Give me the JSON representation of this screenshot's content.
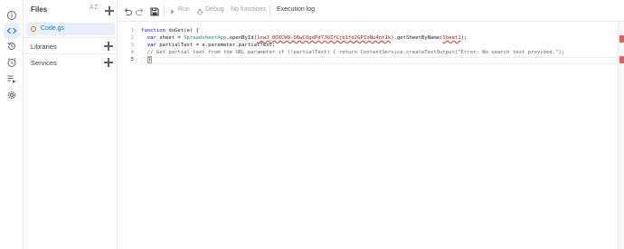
{
  "sidebar": {
    "title": "Files",
    "sort_label": "A Z",
    "files": [
      {
        "name": "Code.gs"
      }
    ],
    "sections": [
      {
        "label": "Libraries"
      },
      {
        "label": "Services"
      }
    ]
  },
  "rail": {
    "icons": [
      "info-icon",
      "code-icon",
      "history-icon",
      "clock-icon",
      "executions-icon",
      "settings-icon"
    ],
    "active": "code-icon"
  },
  "toolbar": {
    "run_label": "Run",
    "debug_label": "Debug",
    "function_select": "No functions",
    "execution_log_label": "Execution log"
  },
  "editor": {
    "line_numbers": [
      "1",
      "2",
      "3",
      "4",
      "5"
    ],
    "current_line": 5,
    "line1": {
      "kw": "function",
      "rest": " doGet(e) {"
    },
    "line2": {
      "indent": "  ",
      "kw": "var",
      "a": " sheet = ",
      "cls": "SpreadsheetApp",
      "b": ".openById(",
      "id": "1nwJ_0OXCW9-S6wCOgdPd7JUZfCjb1fd2GPIoNu4nt1k",
      "c": ").getSheetByName(",
      "sheet": "Sheet1",
      "d": ");"
    },
    "line3": {
      "indent": "  ",
      "kw": "var",
      "rest": " partialText = e.parameter.partialText;"
    },
    "line4": {
      "indent": "  ",
      "comment": "// Get partial text from the URL parameter if (!partialText) { return ContentService.createTextOutput(\"Error: No search text provided.\");"
    },
    "line5": {
      "indent": "  ",
      "brace": "}"
    }
  },
  "colors": {
    "accent": "#1a73e8",
    "active_bg": "#e8f0fe",
    "file_icon": "#e37400",
    "error_marker": "#e35d5b"
  }
}
